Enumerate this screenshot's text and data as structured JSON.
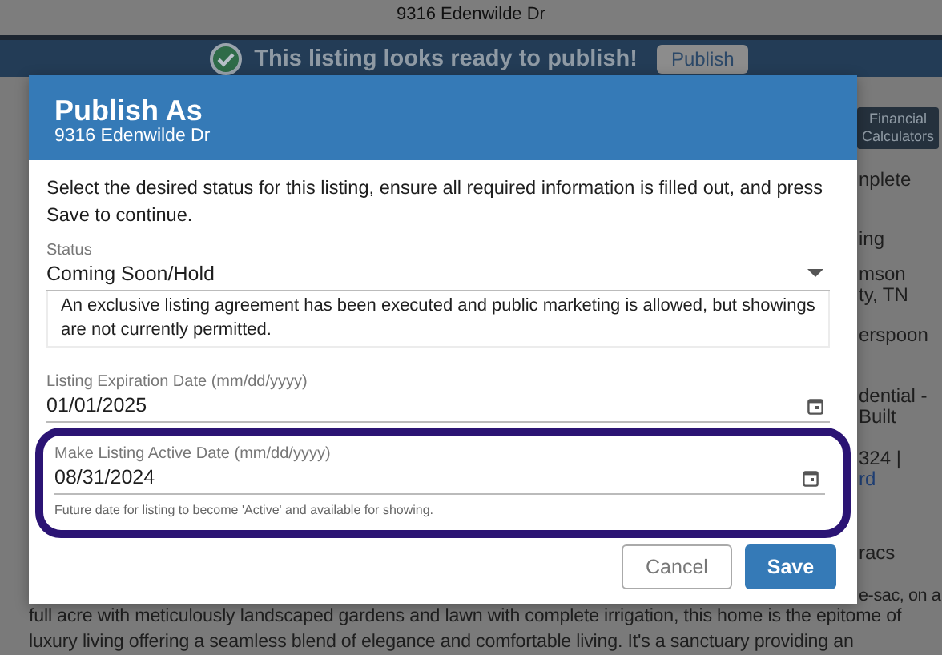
{
  "page": {
    "address": "9316 Edenwilde Dr",
    "banner": {
      "message": "This listing looks ready to publish!",
      "button": "Publish"
    },
    "side_button": "Financial Calculators",
    "side_fragments": [
      {
        "lines": [
          "nplete"
        ]
      },
      {
        "lines": [
          "ing"
        ]
      },
      {
        "lines": [
          "mson",
          "ty, TN"
        ]
      },
      {
        "lines": [
          "erspoon"
        ]
      },
      {
        "lines": [
          "dential -",
          "Built"
        ]
      },
      {
        "lines": [
          "324 |"
        ],
        "link": "rd"
      },
      {
        "lines": [
          "racs"
        ]
      },
      {
        "lines": [
          "e-sac, on a"
        ]
      }
    ],
    "description_lines": [
      "full acre with meticulously landscaped gardens and lawn with complete irrigation, this home is the epitome of",
      "luxury living offering a seamless blend of elegance and comfortable living. It's a sanctuary providing an"
    ]
  },
  "dialog": {
    "title": "Publish As",
    "subtitle": "9316 Edenwilde Dr",
    "instructions": "Select the desired status for this listing, ensure all required information is filled out, and press Save to continue.",
    "status": {
      "label": "Status",
      "value": "Coming Soon/Hold",
      "description": "An exclusive listing agreement has been executed and public marketing is allowed, but showings are not currently permitted."
    },
    "fields": [
      {
        "label": "Listing Expiration Date (mm/dd/yyyy)",
        "value": "01/01/2025",
        "highlighted": false
      },
      {
        "label": "Make Listing Active Date (mm/dd/yyyy)",
        "value": "08/31/2024",
        "hint": "Future date for listing to become 'Active' and available for showing.",
        "highlighted": true
      }
    ],
    "buttons": [
      {
        "label": "Cancel",
        "kind": "secondary"
      },
      {
        "label": "Save",
        "kind": "primary"
      }
    ]
  }
}
